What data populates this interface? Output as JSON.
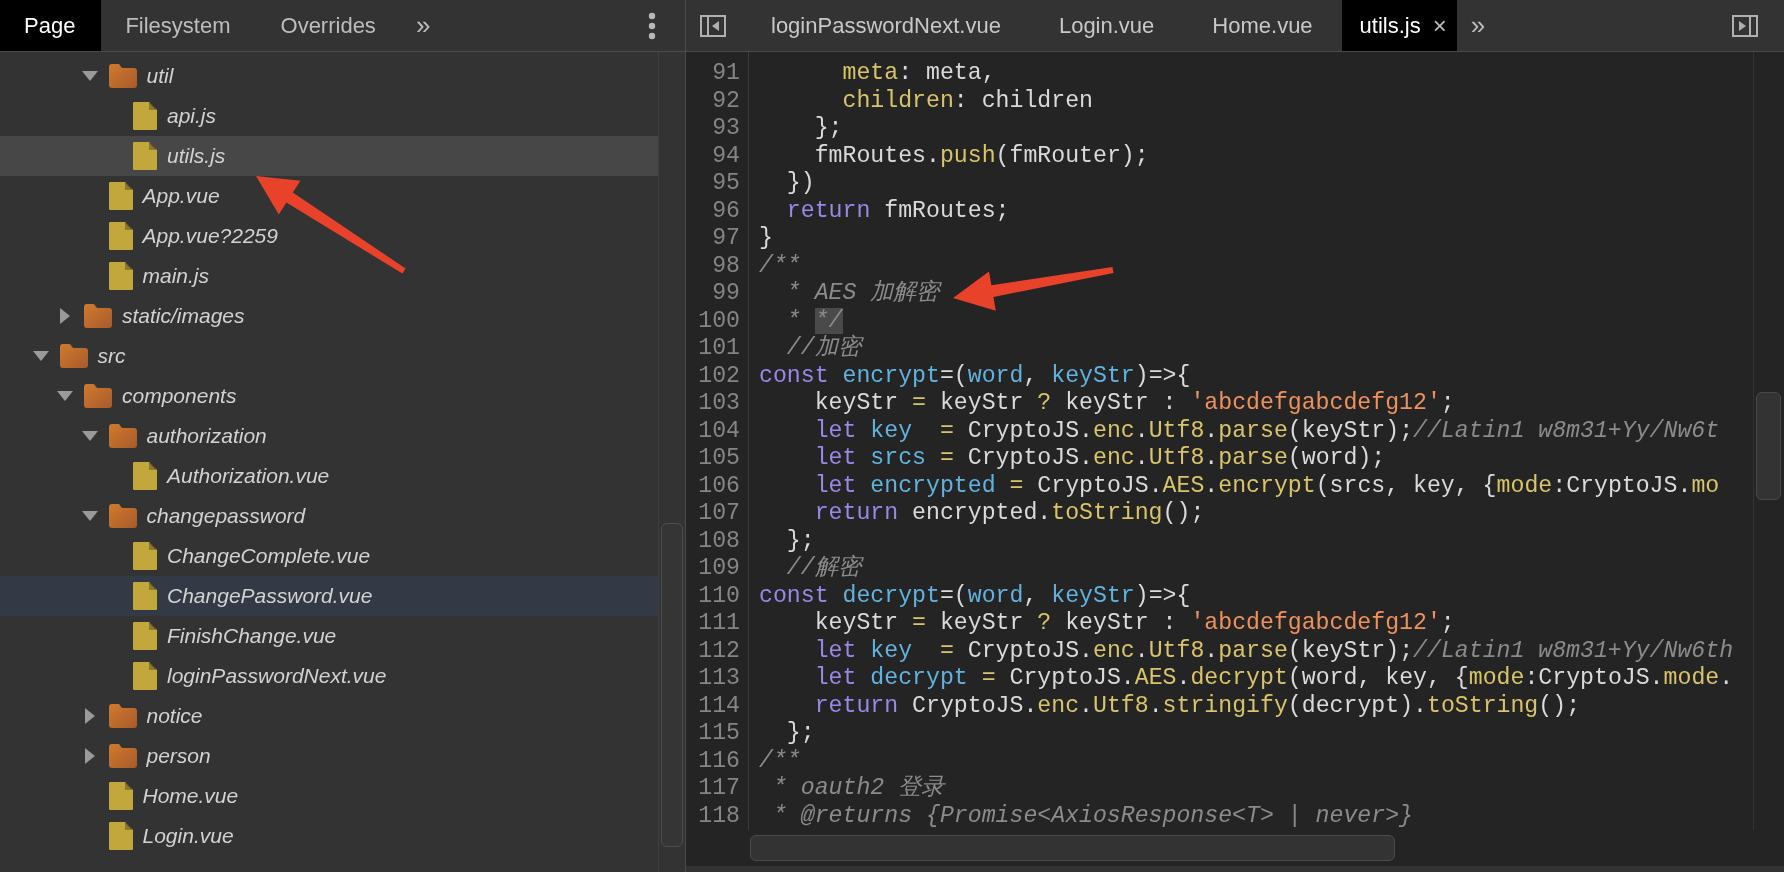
{
  "left_panel": {
    "tabs": [
      {
        "label": "Page",
        "selected": true
      },
      {
        "label": "Filesystem",
        "selected": false
      },
      {
        "label": "Overrides",
        "selected": false
      }
    ],
    "more_tabs": "»",
    "tree": [
      {
        "children": [
          {
            "children": [
              {
                "kind": "folder",
                "label": "util",
                "expanded": true,
                "selected": false,
                "hovered": false,
                "children": [
                  {
                    "kind": "file",
                    "label": "api.js",
                    "selected": false,
                    "hovered": false
                  },
                  {
                    "kind": "file",
                    "label": "utils.js",
                    "selected": true,
                    "hovered": false
                  }
                ]
              },
              {
                "kind": "file",
                "label": "App.vue",
                "selected": false,
                "hovered": false
              },
              {
                "kind": "file",
                "label": "App.vue?2259",
                "selected": false,
                "hovered": false
              },
              {
                "kind": "file",
                "label": "main.js",
                "selected": false,
                "hovered": false
              }
            ]
          },
          {
            "kind": "folder",
            "label": "static/images",
            "expanded": false,
            "selected": false,
            "hovered": false
          }
        ]
      },
      {
        "kind": "folder",
        "label": "src",
        "expanded": true,
        "selected": false,
        "hovered": false,
        "children": [
          {
            "kind": "folder",
            "label": "components",
            "expanded": true,
            "selected": false,
            "hovered": false,
            "children": [
              {
                "kind": "folder",
                "label": "authorization",
                "expanded": true,
                "selected": false,
                "hovered": false,
                "children": [
                  {
                    "kind": "file",
                    "label": "Authorization.vue",
                    "selected": false,
                    "hovered": false
                  }
                ]
              },
              {
                "kind": "folder",
                "label": "changepassword",
                "expanded": true,
                "selected": false,
                "hovered": false,
                "children": [
                  {
                    "kind": "file",
                    "label": "ChangeComplete.vue",
                    "selected": false,
                    "hovered": false
                  },
                  {
                    "kind": "file",
                    "label": "ChangePassword.vue",
                    "selected": false,
                    "hovered": true
                  },
                  {
                    "kind": "file",
                    "label": "FinishChange.vue",
                    "selected": false,
                    "hovered": false
                  },
                  {
                    "kind": "file",
                    "label": "loginPasswordNext.vue",
                    "selected": false,
                    "hovered": false
                  }
                ]
              },
              {
                "kind": "folder",
                "label": "notice",
                "expanded": false,
                "selected": false,
                "hovered": false
              },
              {
                "kind": "folder",
                "label": "person",
                "expanded": false,
                "selected": false,
                "hovered": false
              },
              {
                "kind": "file",
                "label": "Home.vue",
                "selected": false,
                "hovered": false
              },
              {
                "kind": "file",
                "label": "Login.vue",
                "selected": false,
                "hovered": false
              }
            ]
          }
        ]
      }
    ]
  },
  "editor": {
    "tabs": [
      {
        "label": "loginPasswordNext.vue",
        "selected": false
      },
      {
        "label": "Login.vue",
        "selected": false
      },
      {
        "label": "Home.vue",
        "selected": false
      },
      {
        "label": "utils.js",
        "selected": true,
        "close": "×"
      }
    ],
    "more_tabs": "»",
    "lines": [
      {
        "number": "91",
        "tokens": [
          {
            "text": "      meta",
            "kind": "member"
          },
          {
            "text": ": meta,",
            "kind": "plain"
          }
        ]
      },
      {
        "number": "92",
        "tokens": [
          {
            "text": "      children",
            "kind": "member"
          },
          {
            "text": ": children",
            "kind": "plain"
          }
        ]
      },
      {
        "number": "93",
        "tokens": [
          {
            "text": "    };",
            "kind": "plain"
          }
        ]
      },
      {
        "number": "94",
        "tokens": [
          {
            "text": "    fmRoutes.",
            "kind": "plain"
          },
          {
            "text": "push",
            "kind": "member"
          },
          {
            "text": "(fmRouter);",
            "kind": "plain"
          }
        ]
      },
      {
        "number": "95",
        "tokens": [
          {
            "text": "  })",
            "kind": "plain"
          }
        ]
      },
      {
        "number": "96",
        "tokens": [
          {
            "text": "  return",
            "kind": "keyword"
          },
          {
            "text": " fmRoutes;",
            "kind": "plain"
          }
        ]
      },
      {
        "number": "97",
        "tokens": [
          {
            "text": "}",
            "kind": "plain"
          }
        ]
      },
      {
        "number": "98",
        "tokens": [
          {
            "text": "/**",
            "kind": "comment"
          }
        ]
      },
      {
        "number": "99",
        "tokens": [
          {
            "text": "  * AES 加解密",
            "kind": "comment"
          }
        ]
      },
      {
        "number": "100",
        "tokens": [
          {
            "text": "  * ",
            "kind": "comment"
          },
          {
            "text": "*/",
            "kind": "match"
          }
        ]
      },
      {
        "number": "101",
        "tokens": [
          {
            "text": "  //加密",
            "kind": "comment"
          }
        ]
      },
      {
        "number": "102",
        "tokens": [
          {
            "text": "const ",
            "kind": "keyword"
          },
          {
            "text": "encrypt",
            "kind": "definition"
          },
          {
            "text": "=(",
            "kind": "plain"
          },
          {
            "text": "word",
            "kind": "definition"
          },
          {
            "text": ", ",
            "kind": "plain"
          },
          {
            "text": "keyStr",
            "kind": "definition"
          },
          {
            "text": ")=>{",
            "kind": "plain"
          }
        ]
      },
      {
        "number": "103",
        "tokens": [
          {
            "text": "    keyStr ",
            "kind": "plain"
          },
          {
            "text": "=",
            "kind": "operator"
          },
          {
            "text": " keyStr ",
            "kind": "plain"
          },
          {
            "text": "?",
            "kind": "operator"
          },
          {
            "text": " keyStr : ",
            "kind": "plain"
          },
          {
            "text": "'abcdefgabcdefg12'",
            "kind": "string"
          },
          {
            "text": ";",
            "kind": "plain"
          }
        ]
      },
      {
        "number": "104",
        "tokens": [
          {
            "text": "    let ",
            "kind": "keyword"
          },
          {
            "text": "key  ",
            "kind": "definition"
          },
          {
            "text": "=",
            "kind": "operator"
          },
          {
            "text": " CryptoJS.",
            "kind": "plain"
          },
          {
            "text": "enc",
            "kind": "member"
          },
          {
            "text": ".",
            "kind": "plain"
          },
          {
            "text": "Utf8",
            "kind": "member"
          },
          {
            "text": ".",
            "kind": "plain"
          },
          {
            "text": "parse",
            "kind": "member"
          },
          {
            "text": "(keyStr);",
            "kind": "plain"
          },
          {
            "text": "//Latin1 w8m31+Yy/Nw6t",
            "kind": "comment"
          }
        ]
      },
      {
        "number": "105",
        "tokens": [
          {
            "text": "    let ",
            "kind": "keyword"
          },
          {
            "text": "srcs ",
            "kind": "definition"
          },
          {
            "text": "=",
            "kind": "operator"
          },
          {
            "text": " CryptoJS.",
            "kind": "plain"
          },
          {
            "text": "enc",
            "kind": "member"
          },
          {
            "text": ".",
            "kind": "plain"
          },
          {
            "text": "Utf8",
            "kind": "member"
          },
          {
            "text": ".",
            "kind": "plain"
          },
          {
            "text": "parse",
            "kind": "member"
          },
          {
            "text": "(word);",
            "kind": "plain"
          }
        ]
      },
      {
        "number": "106",
        "tokens": [
          {
            "text": "    let ",
            "kind": "keyword"
          },
          {
            "text": "encrypted ",
            "kind": "definition"
          },
          {
            "text": "=",
            "kind": "operator"
          },
          {
            "text": " CryptoJS.",
            "kind": "plain"
          },
          {
            "text": "AES",
            "kind": "member"
          },
          {
            "text": ".",
            "kind": "plain"
          },
          {
            "text": "encrypt",
            "kind": "member"
          },
          {
            "text": "(srcs, key, {",
            "kind": "plain"
          },
          {
            "text": "mode",
            "kind": "member"
          },
          {
            "text": ":CryptoJS.",
            "kind": "plain"
          },
          {
            "text": "mo",
            "kind": "member"
          }
        ]
      },
      {
        "number": "107",
        "tokens": [
          {
            "text": "    return",
            "kind": "keyword"
          },
          {
            "text": " encrypted.",
            "kind": "plain"
          },
          {
            "text": "toString",
            "kind": "member"
          },
          {
            "text": "();",
            "kind": "plain"
          }
        ]
      },
      {
        "number": "108",
        "tokens": [
          {
            "text": "  };",
            "kind": "plain"
          }
        ]
      },
      {
        "number": "109",
        "tokens": [
          {
            "text": "  //解密",
            "kind": "comment"
          }
        ]
      },
      {
        "number": "110",
        "tokens": [
          {
            "text": "const ",
            "kind": "keyword"
          },
          {
            "text": "decrypt",
            "kind": "definition"
          },
          {
            "text": "=(",
            "kind": "plain"
          },
          {
            "text": "word",
            "kind": "definition"
          },
          {
            "text": ", ",
            "kind": "plain"
          },
          {
            "text": "keyStr",
            "kind": "definition"
          },
          {
            "text": ")=>{",
            "kind": "plain"
          }
        ]
      },
      {
        "number": "111",
        "tokens": [
          {
            "text": "    keyStr ",
            "kind": "plain"
          },
          {
            "text": "=",
            "kind": "operator"
          },
          {
            "text": " keyStr ",
            "kind": "plain"
          },
          {
            "text": "?",
            "kind": "operator"
          },
          {
            "text": " keyStr : ",
            "kind": "plain"
          },
          {
            "text": "'abcdefgabcdefg12'",
            "kind": "string"
          },
          {
            "text": ";",
            "kind": "plain"
          }
        ]
      },
      {
        "number": "112",
        "tokens": [
          {
            "text": "    let ",
            "kind": "keyword"
          },
          {
            "text": "key  ",
            "kind": "definition"
          },
          {
            "text": "=",
            "kind": "operator"
          },
          {
            "text": " CryptoJS.",
            "kind": "plain"
          },
          {
            "text": "enc",
            "kind": "member"
          },
          {
            "text": ".",
            "kind": "plain"
          },
          {
            "text": "Utf8",
            "kind": "member"
          },
          {
            "text": ".",
            "kind": "plain"
          },
          {
            "text": "parse",
            "kind": "member"
          },
          {
            "text": "(keyStr);",
            "kind": "plain"
          },
          {
            "text": "//Latin1 w8m31+Yy/Nw6th",
            "kind": "comment"
          }
        ]
      },
      {
        "number": "113",
        "tokens": [
          {
            "text": "    let ",
            "kind": "keyword"
          },
          {
            "text": "decrypt ",
            "kind": "definition"
          },
          {
            "text": "=",
            "kind": "operator"
          },
          {
            "text": " CryptoJS.",
            "kind": "plain"
          },
          {
            "text": "AES",
            "kind": "member"
          },
          {
            "text": ".",
            "kind": "plain"
          },
          {
            "text": "decrypt",
            "kind": "member"
          },
          {
            "text": "(word, key, {",
            "kind": "plain"
          },
          {
            "text": "mode",
            "kind": "member"
          },
          {
            "text": ":CryptoJS.",
            "kind": "plain"
          },
          {
            "text": "mode",
            "kind": "member"
          },
          {
            "text": ".",
            "kind": "plain"
          }
        ]
      },
      {
        "number": "114",
        "tokens": [
          {
            "text": "    return",
            "kind": "keyword"
          },
          {
            "text": " CryptoJS.",
            "kind": "plain"
          },
          {
            "text": "enc",
            "kind": "member"
          },
          {
            "text": ".",
            "kind": "plain"
          },
          {
            "text": "Utf8",
            "kind": "member"
          },
          {
            "text": ".",
            "kind": "plain"
          },
          {
            "text": "stringify",
            "kind": "member"
          },
          {
            "text": "(decrypt).",
            "kind": "plain"
          },
          {
            "text": "toString",
            "kind": "member"
          },
          {
            "text": "();",
            "kind": "plain"
          }
        ]
      },
      {
        "number": "115",
        "tokens": [
          {
            "text": "  };",
            "kind": "plain"
          }
        ]
      },
      {
        "number": "116",
        "tokens": [
          {
            "text": "/**",
            "kind": "comment"
          }
        ]
      },
      {
        "number": "117",
        "tokens": [
          {
            "text": " * oauth2 登录",
            "kind": "comment"
          }
        ]
      },
      {
        "number": "118",
        "tokens": [
          {
            "text": " * @returns {Promise<AxiosResponse<T> | never>}",
            "kind": "comment"
          }
        ]
      }
    ]
  }
}
